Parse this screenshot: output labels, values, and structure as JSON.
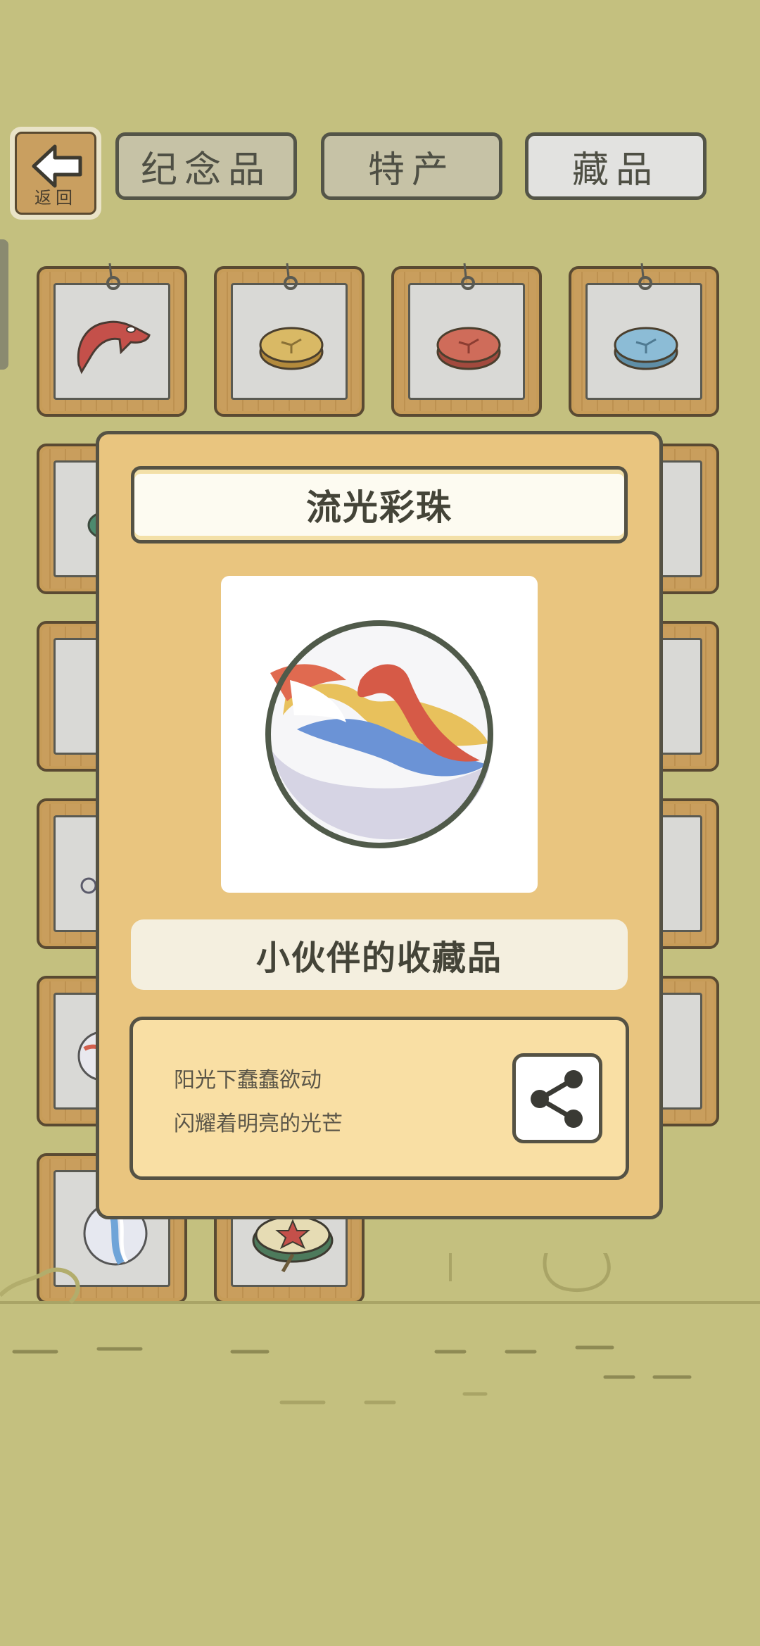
{
  "header": {
    "back_label": "返回",
    "tabs": [
      {
        "label": "纪念品",
        "active": false
      },
      {
        "label": "特产",
        "active": false
      },
      {
        "label": "藏品",
        "active": true
      }
    ]
  },
  "popup": {
    "item_name": "流光彩珠",
    "category": "小伙伴的收藏品",
    "description_lines": [
      "阳光下蠢蠢欲动",
      "闪耀着明亮的光芒"
    ],
    "share_icon": "share-icon"
  },
  "grid": {
    "items": [
      "red-creature-figure",
      "yellow-coin-disc",
      "red-coin-disc",
      "blue-coin-disc",
      "green-disc",
      "marble",
      "starfish-disc"
    ]
  },
  "colors": {
    "background": "#c4c07f",
    "popup_bg": "#e9c57f",
    "tab_active": "#e2e2e0",
    "tab_inactive": "#c6c2a6"
  }
}
